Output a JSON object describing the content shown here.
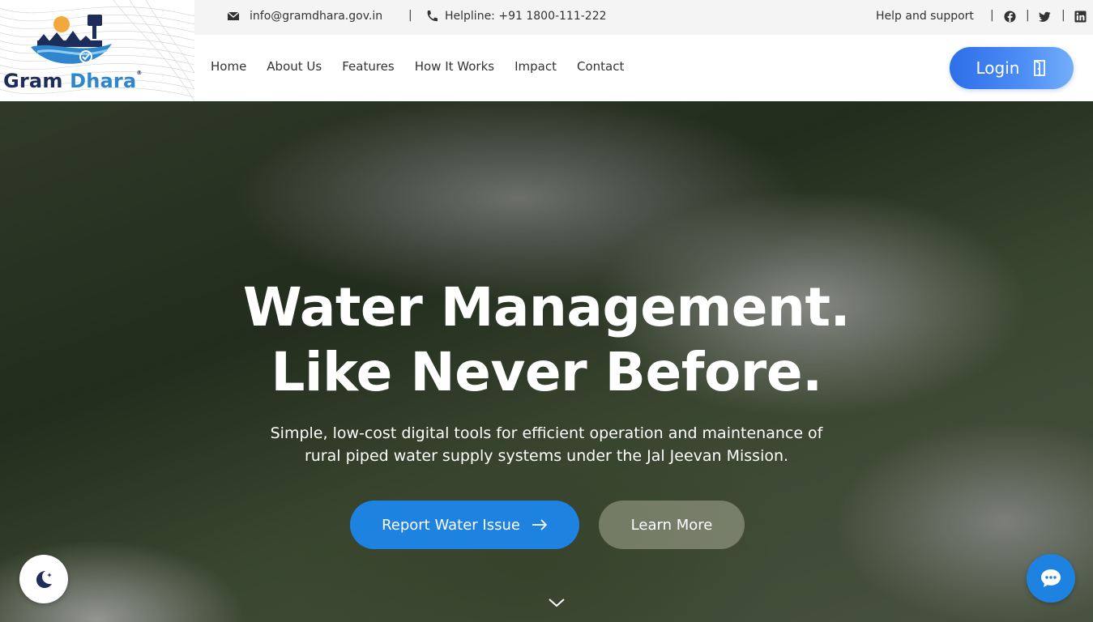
{
  "brand": {
    "name_part1": "Gram",
    "name_part2": "Dhara",
    "mark": "®"
  },
  "topbar": {
    "email": "info@gramdhara.gov.in",
    "helpline": "Helpline: +91 1800-111-222",
    "help": "Help and support",
    "separator": "|",
    "socials": [
      "facebook-icon",
      "twitter-icon",
      "linkedin-icon"
    ]
  },
  "nav": {
    "items": [
      "Home",
      "About Us",
      "Features",
      "How It Works",
      "Impact",
      "Contact"
    ],
    "login_label": "Login"
  },
  "hero": {
    "title_line1": "Water Management.",
    "title_line2": "Like Never Before.",
    "subtitle_line1": "Simple, low-cost digital tools for efficient operation and maintenance of",
    "subtitle_line2": "rural piped water supply systems under the Jal Jeevan Mission.",
    "primary_cta": "Report Water Issue",
    "secondary_cta": "Learn More"
  },
  "colors": {
    "primary": "#1e82e0",
    "login_gradient_start": "#2e6ee8",
    "brand_dark": "#1e2c59",
    "brand_light": "#2f86cc"
  },
  "icons": {
    "email": "mail-icon",
    "phone": "phone-icon",
    "theme": "moon-icon",
    "chat": "chat-icon",
    "scroll": "chevron-down-icon",
    "login": "door-icon",
    "arrow": "arrow-right-icon"
  }
}
